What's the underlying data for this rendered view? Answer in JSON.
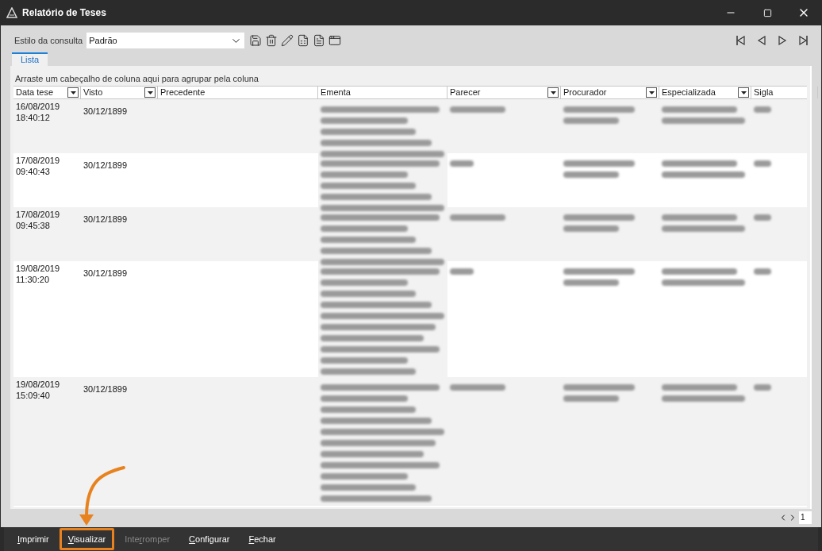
{
  "window": {
    "title": "Relatório de Teses"
  },
  "toolbar": {
    "style_label": "Estilo da consulta",
    "style_value": "Padrão"
  },
  "tabs": [
    {
      "label": "Lista",
      "selected": true
    }
  ],
  "grid": {
    "group_hint": "Arraste um cabeçalho de coluna aqui para agrupar pela coluna",
    "columns": [
      {
        "label": "Data tese",
        "filter": true
      },
      {
        "label": "Visto",
        "filter": true
      },
      {
        "label": "Precedente",
        "filter": false
      },
      {
        "label": "Ementa",
        "filter": false
      },
      {
        "label": "Parecer",
        "filter": true
      },
      {
        "label": "Procurador",
        "filter": true
      },
      {
        "label": "Especializada",
        "filter": true
      },
      {
        "label": "Sigla",
        "filter": false
      }
    ],
    "rows": [
      {
        "date": "16/08/2019",
        "time": "18:40:12",
        "visto": "30/12/1899",
        "kind": "short"
      },
      {
        "date": "17/08/2019",
        "time": "09:40:43",
        "visto": "30/12/1899",
        "kind": "short"
      },
      {
        "date": "17/08/2019",
        "time": "09:45:38",
        "visto": "30/12/1899",
        "kind": "short"
      },
      {
        "date": "19/08/2019",
        "time": "11:30:20",
        "visto": "30/12/1899",
        "kind": "long"
      },
      {
        "date": "19/08/2019",
        "time": "15:09:40",
        "visto": "30/12/1899",
        "kind": "longer"
      }
    ]
  },
  "pager": {
    "page": "1"
  },
  "buttons": [
    {
      "label": [
        {
          "text": "I",
          "underline": true
        },
        {
          "text": "mprimir",
          "underline": false
        }
      ],
      "disabled": false,
      "highlighted": false
    },
    {
      "label": [
        {
          "text": "V",
          "underline": true
        },
        {
          "text": "isualizar",
          "underline": false
        }
      ],
      "disabled": false,
      "highlighted": true
    },
    {
      "label": [
        {
          "text": "Inte",
          "underline": false
        },
        {
          "text": "r",
          "underline": true
        },
        {
          "text": "romper",
          "underline": false
        }
      ],
      "disabled": true,
      "highlighted": false
    },
    {
      "label": [
        {
          "text": "C",
          "underline": true
        },
        {
          "text": "onfigurar",
          "underline": false
        }
      ],
      "disabled": false,
      "highlighted": false
    },
    {
      "label": [
        {
          "text": "F",
          "underline": true
        },
        {
          "text": "echar",
          "underline": false
        }
      ],
      "disabled": false,
      "highlighted": false
    }
  ]
}
